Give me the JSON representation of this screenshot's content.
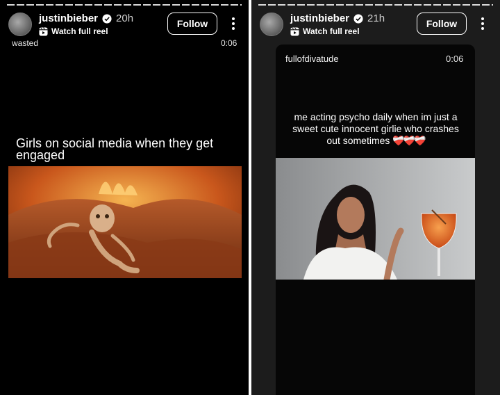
{
  "stories": [
    {
      "username": "justinbieber",
      "time": "20h",
      "reel_label": "Watch full reel",
      "follow_label": "Follow",
      "tag": "wasted",
      "duration": "0:06",
      "caption": "Girls on social media when they get engaged"
    },
    {
      "username": "justinbieber",
      "time": "21h",
      "reel_label": "Watch full reel",
      "follow_label": "Follow",
      "source": "fullofdivatude",
      "duration": "0:06",
      "caption": "me acting psycho daily when im just a sweet cute innocent girlie who crashes out sometimes",
      "hearts": "❤️‍🩹❤️‍🩹❤️‍🩹"
    }
  ],
  "icons": {
    "avatar": "avatar",
    "verified": "verified-badge-icon",
    "reel": "reel-icon",
    "more": "more-options-icon"
  },
  "colors": {
    "background_left": "#000000",
    "background_right": "#1c1c1c",
    "heart": "#e0243c"
  }
}
